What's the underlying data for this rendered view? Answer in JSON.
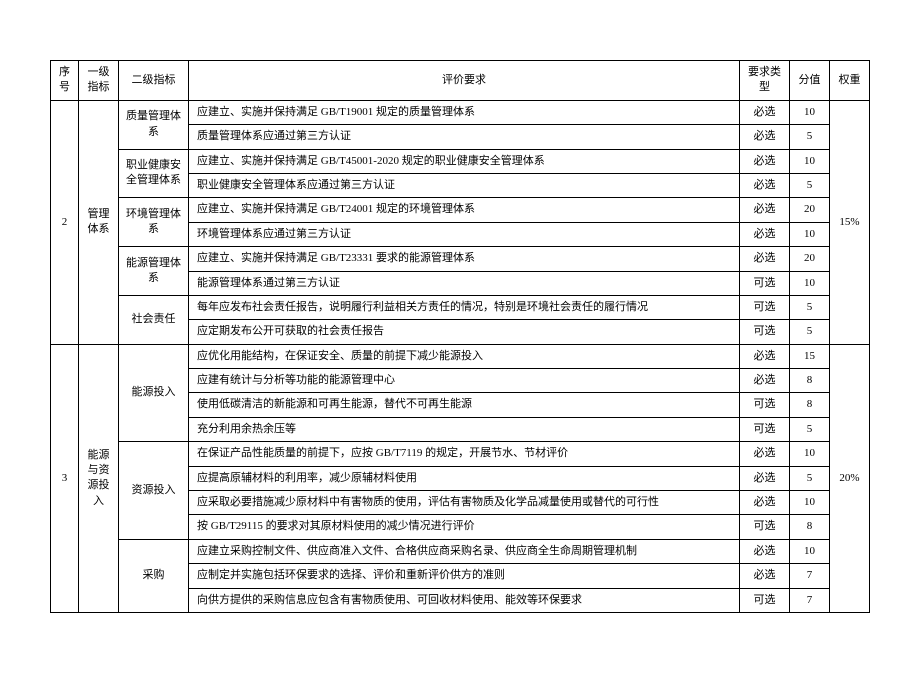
{
  "headers": {
    "seq": "序号",
    "lvl1": "一级指标",
    "lvl2": "二级指标",
    "req": "评价要求",
    "type": "要求类型",
    "score": "分值",
    "weight": "权重"
  },
  "groups": [
    {
      "seq": "2",
      "lvl1": "管理体系",
      "weight": "15%",
      "subs": [
        {
          "lvl2": "质量管理体系",
          "rows": [
            {
              "req": "应建立、实施并保持满足 GB/T19001 规定的质量管理体系",
              "type": "必选",
              "score": "10"
            },
            {
              "req": "质量管理体系应通过第三方认证",
              "type": "必选",
              "score": "5"
            }
          ]
        },
        {
          "lvl2": "职业健康安全管理体系",
          "rows": [
            {
              "req": "应建立、实施并保持满足 GB/T45001-2020 规定的职业健康安全管理体系",
              "type": "必选",
              "score": "10"
            },
            {
              "req": "职业健康安全管理体系应通过第三方认证",
              "type": "必选",
              "score": "5"
            }
          ]
        },
        {
          "lvl2": "环境管理体系",
          "rows": [
            {
              "req": "应建立、实施并保持满足 GB/T24001 规定的环境管理体系",
              "type": "必选",
              "score": "20"
            },
            {
              "req": "环境管理体系应通过第三方认证",
              "type": "必选",
              "score": "10"
            }
          ]
        },
        {
          "lvl2": "能源管理体系",
          "rows": [
            {
              "req": "应建立、实施并保持满足 GB/T23331 要求的能源管理体系",
              "type": "必选",
              "score": "20"
            },
            {
              "req": "能源管理体系通过第三方认证",
              "type": "可选",
              "score": "10"
            }
          ]
        },
        {
          "lvl2": "社会责任",
          "rows": [
            {
              "req": "每年应发布社会责任报告，说明履行利益相关方责任的情况，特别是环境社会责任的履行情况",
              "type": "可选",
              "score": "5"
            },
            {
              "req": "应定期发布公开可获取的社会责任报告",
              "type": "可选",
              "score": "5"
            }
          ]
        }
      ]
    },
    {
      "seq": "3",
      "lvl1": "能源与资源投入",
      "weight": "20%",
      "subs": [
        {
          "lvl2": "能源投入",
          "rows": [
            {
              "req": "应优化用能结构，在保证安全、质量的前提下减少能源投入",
              "type": "必选",
              "score": "15"
            },
            {
              "req": "应建有统计与分析等功能的能源管理中心",
              "type": "必选",
              "score": "8"
            },
            {
              "req": "使用低碳清洁的新能源和可再生能源，替代不可再生能源",
              "type": "可选",
              "score": "8"
            },
            {
              "req": "充分利用余热余压等",
              "type": "可选",
              "score": "5"
            }
          ]
        },
        {
          "lvl2": "资源投入",
          "rows": [
            {
              "req": "在保证产品性能质量的前提下，应按 GB/T7119 的规定，开展节水、节材评价",
              "type": "必选",
              "score": "10"
            },
            {
              "req": "应提高原辅材料的利用率，减少原辅材料使用",
              "type": "必选",
              "score": "5"
            },
            {
              "req": "应采取必要措施减少原材料中有害物质的使用，评估有害物质及化学品减量使用或替代的可行性",
              "type": "必选",
              "score": "10"
            },
            {
              "req": "按 GB/T29115 的要求对其原材料使用的减少情况进行评价",
              "type": "可选",
              "score": "8"
            }
          ]
        },
        {
          "lvl2": "采购",
          "rows": [
            {
              "req": "应建立采购控制文件、供应商准入文件、合格供应商采购名录、供应商全生命周期管理机制",
              "type": "必选",
              "score": "10"
            },
            {
              "req": "应制定并实施包括环保要求的选择、评价和重新评价供方的准则",
              "type": "必选",
              "score": "7"
            },
            {
              "req": "向供方提供的采购信息应包含有害物质使用、可回收材料使用、能效等环保要求",
              "type": "可选",
              "score": "7"
            }
          ]
        }
      ]
    }
  ]
}
